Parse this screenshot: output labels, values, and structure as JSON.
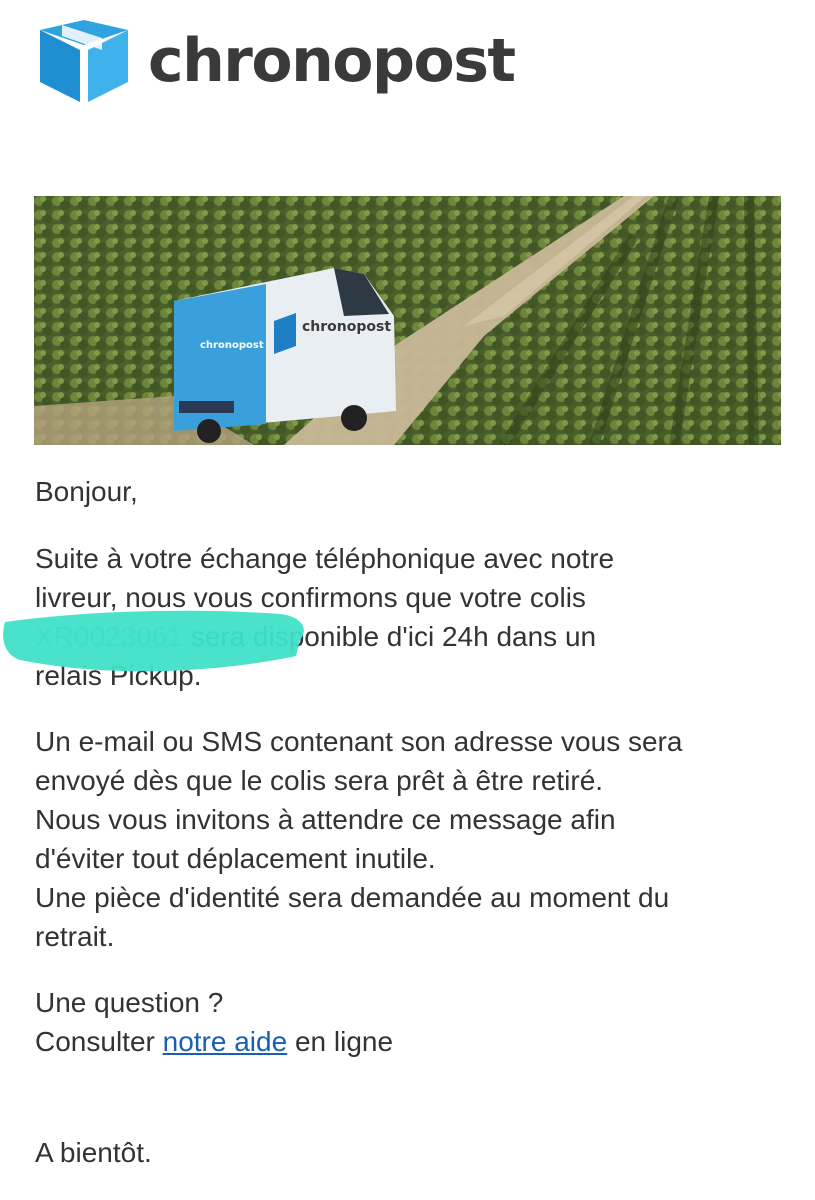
{
  "brand": {
    "name": "chronopost",
    "accent_color": "#2ea3e0",
    "text_color": "#3a3a3c"
  },
  "hero": {
    "van_brand": "chronopost",
    "icon": "package-cube-icon"
  },
  "email": {
    "greeting": "Bonjour,",
    "paragraph1_line1": "Suite à votre échange téléphonique avec notre",
    "paragraph1_line2": "livreur, nous vous confirmons que votre colis",
    "paragraph1_tracking": "XR0023061",
    "paragraph1_line3_rest": "sera disponible d'ici 24h dans un",
    "paragraph1_line4": "relais Pickup.",
    "paragraph2_line1": "Un e-mail ou SMS contenant son adresse vous sera",
    "paragraph2_line2": "envoyé dès que le colis sera prêt à être retiré.",
    "paragraph2_line3": "Nous vous invitons à attendre ce message afin",
    "paragraph2_line4": "d'éviter tout déplacement inutile.",
    "paragraph2_line5": "Une pièce d'identité sera demandée au moment du",
    "paragraph2_line6": "retrait.",
    "question": "Une question ?",
    "help_prefix": "Consulter",
    "help_link": "notre aide",
    "help_suffix": "en ligne",
    "signoff": "A bientôt.",
    "link_color": "#1a5fb4",
    "redaction_color": "#40e0c8"
  }
}
